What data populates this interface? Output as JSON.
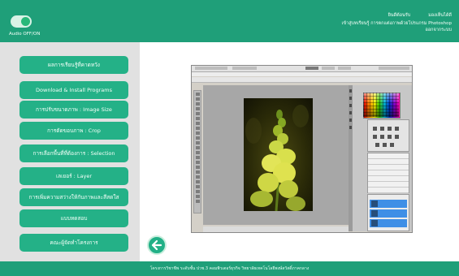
{
  "header": {
    "audio_toggle_label": "Audio OFF/ON",
    "line1_left": "ยินดีต้อนรับ",
    "line1_right": "มองเห็นได้ดี",
    "line2": "เข้าสู่บทเรียนรู้ การตกแต่งภาพด้วยโปรแกรม Photoshop",
    "line3": "ออกจากระบบ",
    "colors": {
      "bar": "#1f9f79",
      "button": "#24b187"
    }
  },
  "sidebar": {
    "items": [
      {
        "label": "ผลการเรียนรู้ที่คาดหวัง"
      },
      {
        "label": "Download & Install Programs"
      },
      {
        "label": "การปรับขนาดภาพ : Image Size"
      },
      {
        "label": "การตัดขอบภาพ : Crop"
      },
      {
        "label": "การเลือกพื้นที่ที่ต้องการ : Selection"
      },
      {
        "label": "เลเยอร์ : Layer"
      },
      {
        "label": "การเพิ่มความสว่างให้กับภาพและสีสดใส"
      },
      {
        "label": "แบบทดสอบ"
      },
      {
        "label": "คณะผู้จัดทำโครงการ"
      }
    ]
  },
  "back_button": {
    "icon": "arrow-left-icon"
  },
  "footer": {
    "text": "โครงการวิชาชีพ ระดับชั้น ปวช.3 คอมพิวเตอร์ธุรกิจ วิทยาลัยเทคโนโลยีพงษ์สวัสดิ์ภาคกลาง"
  }
}
